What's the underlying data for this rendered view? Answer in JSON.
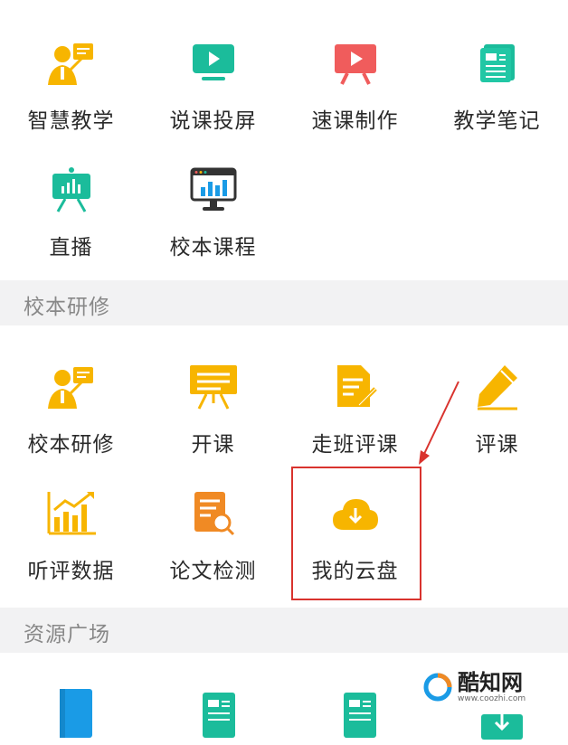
{
  "teaching_tools": {
    "items": [
      {
        "label": "智慧教学",
        "icon": "teacher-icon"
      },
      {
        "label": "说课投屏",
        "icon": "screen-play-icon"
      },
      {
        "label": "速课制作",
        "icon": "video-board-icon"
      },
      {
        "label": "教学笔记",
        "icon": "notes-icon"
      },
      {
        "label": "直播",
        "icon": "live-easel-icon"
      },
      {
        "label": "校本课程",
        "icon": "monitor-chart-icon"
      }
    ]
  },
  "sections": {
    "school_training": {
      "title": "校本研修",
      "items": [
        {
          "label": "校本研修",
          "icon": "teacher-icon"
        },
        {
          "label": "开课",
          "icon": "presentation-icon"
        },
        {
          "label": "走班评课",
          "icon": "document-edit-icon"
        },
        {
          "label": "评课",
          "icon": "pencil-icon"
        },
        {
          "label": "听评数据",
          "icon": "bar-chart-icon"
        },
        {
          "label": "论文检测",
          "icon": "document-search-icon"
        },
        {
          "label": "我的云盘",
          "icon": "cloud-download-icon"
        }
      ]
    },
    "resources": {
      "title": "资源广场"
    }
  },
  "watermark": {
    "name": "酷知网",
    "url": "www.coozhi.com"
  },
  "colors": {
    "yellow": "#f7b500",
    "teal": "#1bbc9b",
    "red": "#f05c5c",
    "blue": "#1a9be6",
    "highlight": "#d9332e"
  }
}
